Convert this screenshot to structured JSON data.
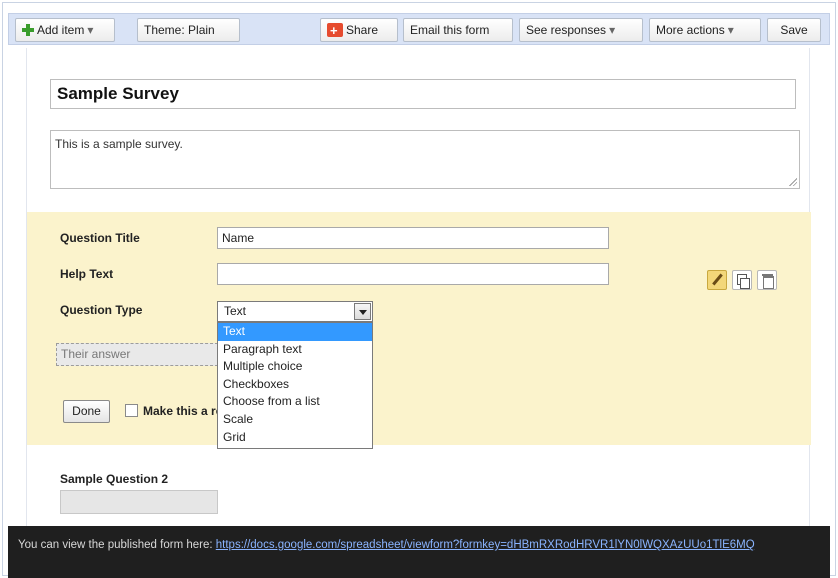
{
  "toolbar": {
    "add_item": "Add item",
    "theme_label": "Theme:",
    "theme_value": "Plain",
    "share": "Share",
    "email_form": "Email this form",
    "see_responses": "See responses",
    "more_actions": "More actions",
    "save": "Save",
    "dropdown_arrow": "▾"
  },
  "form": {
    "title": "Sample Survey",
    "description": "This is a sample survey."
  },
  "question_editor": {
    "title_label": "Question Title",
    "title_value": "Name",
    "help_label": "Help Text",
    "help_value": "",
    "type_label": "Question Type",
    "type_selected": "Text",
    "type_options": [
      "Text",
      "Paragraph text",
      "Multiple choice",
      "Checkboxes",
      "Choose from a list",
      "Scale",
      "Grid"
    ],
    "answer_placeholder": "Their answer",
    "done": "Done",
    "required_label": "Make this a required question"
  },
  "question2": {
    "label": "Sample Question 2"
  },
  "footer": {
    "text": "You can view the published form here:",
    "link": "https://docs.google.com/spreadsheet/viewform?formkey=dHBmRXRodHRVR1lYN0lWQXAzUUo1TlE6MQ"
  },
  "colors": {
    "toolbar_bg": "#d9e3f6",
    "question_panel_bg": "#fbf3cc",
    "selection_blue": "#3399ff",
    "footer_bg": "#1f1f1f",
    "link_blue": "#8ab4ff"
  },
  "icons": [
    "plus-icon",
    "share-icon",
    "chevron-down-icon",
    "pencil-icon",
    "copy-icon",
    "trash-icon",
    "resize-grip-icon"
  ]
}
